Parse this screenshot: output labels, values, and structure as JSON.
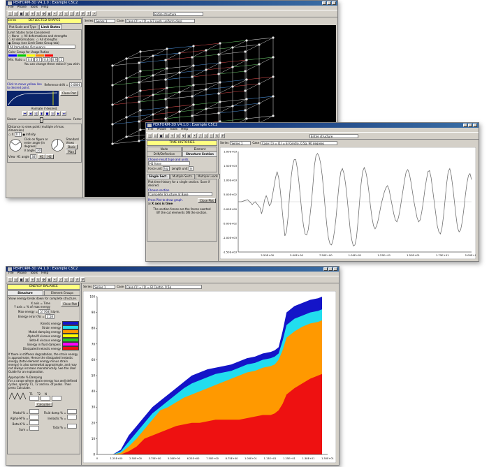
{
  "win1": {
    "title": "PERFORM-3D V4.1.0 : Example C5C2",
    "menu": [
      "File",
      "Phase",
      "Tools",
      "Help"
    ],
    "series": "Series 1",
    "case": "Case (2) = (7) = H7 push, uniform displ",
    "dropdown": "Entire structure",
    "panel_header": "DEFLECTED SHAPES",
    "tabs": [
      "Plot Scale and Type",
      "Limit States"
    ],
    "limit_title": "Limit States to be Considered",
    "opts": [
      "None",
      "All deformations and strengths",
      "All deformations",
      "All strengths",
      "Group (see Limit State Group tab)"
    ],
    "group_select": "All Immediate Occupancy",
    "color_group": "Color Group for Usage Ratios",
    "min_ratio_label": "Min. Ratio =",
    "ratios": [
      "0.6",
      "0.7",
      "0.8",
      "0.9",
      "1"
    ],
    "hint": "You can change these ratios if you wish.",
    "click_hint": "Click to move yellow line to desired point.",
    "ref_label": "Reference drift =",
    "ref_value": "0.0806",
    "close": "Close Plot",
    "animate": "Animate if desired.",
    "slower": "Slower",
    "faster": "Faster",
    "distance_label": "Distance to view point (multiple of max. dimension)",
    "x_label": "X",
    "x_value": "0.1",
    "infinity": "Infinity",
    "click_fig": "Click on figure or enter angle (in degrees)",
    "v_angle": "V angle",
    "v_value": "30",
    "h1_angle": "H1 angle",
    "h1_value": "30",
    "std_views": "Standard Views",
    "views": [
      "Basic",
      "Plan",
      "H1",
      "H2"
    ],
    "view": "View"
  },
  "win2": {
    "title": "PERFORM-3D V4.1.0 : Example C5C2",
    "panel_header": "TIME HISTORIES",
    "menu": [
      "File",
      "Phase",
      "Tools",
      "Help"
    ],
    "series": "Series 1",
    "case": "Case (1) = (1) = El Centro, 0.5g, 90 degrees",
    "dropdown": "Entire structure",
    "tabs_top": [
      "Node",
      "Element"
    ],
    "tabs_mid": [
      "Drift/Deflection",
      "Structure Section"
    ],
    "choose_result": "Choose result type and units.",
    "result": "H1 force",
    "force_unit_label": "Force unit",
    "force_unit": "kip",
    "length_unit_label": "Length unit",
    "length_unit": "in",
    "tabs_sub": [
      "Single Sect.",
      "Multiple Sects.",
      "Multiple Loads"
    ],
    "plot_desc": "Plot time history for a single section. Save if desired.",
    "choose_section": "Choose section",
    "section": "Complete Structure at Base",
    "press_plot": "Press Plot to draw graph.",
    "x_axis": "X axis is time",
    "close": "Close Plot",
    "note": "The section forces are the forces exerted BY the cut elements ON the section.",
    "chart_data": {
      "type": "line",
      "x": [
        0.0,
        0.2,
        0.4,
        0.6,
        0.8,
        0.9,
        1.0,
        1.1,
        1.2,
        1.3,
        1.4,
        1.5,
        1.6,
        1.7,
        1.8,
        1.9,
        2.0,
        2.1,
        2.2,
        2.3,
        2.4,
        2.5,
        2.6,
        2.7,
        2.8,
        2.9,
        3.0,
        3.1,
        3.2,
        3.3,
        3.4,
        3.5,
        3.6,
        3.7,
        3.8,
        3.9,
        4.0,
        4.1,
        4.2,
        4.3,
        4.4,
        4.5,
        4.6,
        4.7,
        4.8,
        4.9,
        5.0,
        5.1,
        5.2,
        5.3,
        5.4,
        5.5,
        5.6,
        5.7,
        5.8,
        5.9,
        6.0,
        6.1,
        6.2,
        6.3,
        6.4,
        6.5,
        6.6,
        6.7,
        6.8,
        6.9,
        7.0,
        7.1,
        7.2,
        7.3,
        7.4,
        7.5,
        7.6,
        7.7,
        7.8,
        7.9,
        8.0,
        8.1,
        8.2,
        8.3,
        8.4,
        8.5,
        8.6,
        8.7,
        8.8,
        8.9,
        9.0,
        9.1,
        9.2,
        9.3,
        9.4,
        9.5,
        9.6,
        9.7,
        9.8,
        9.9,
        10.0,
        10.1,
        10.2,
        10.3,
        10.4,
        10.5,
        10.6,
        10.7,
        10.8,
        10.9,
        11.0,
        11.1,
        11.2,
        11.3,
        11.4,
        11.5,
        11.6,
        11.7,
        11.8,
        11.9,
        12.0,
        12.1,
        12.2,
        12.3,
        12.4,
        12.5,
        12.6,
        12.7,
        12.8,
        12.9,
        13.0,
        13.1,
        13.2,
        13.3,
        13.4,
        13.5,
        13.6,
        13.7,
        13.8,
        13.9,
        14.0,
        14.1,
        14.2,
        14.3,
        14.4,
        14.5,
        14.6,
        14.7,
        14.8,
        14.9,
        15.0
      ],
      "y": [
        0,
        0,
        10,
        20,
        -10,
        -30,
        -10,
        0,
        -20,
        -40,
        -60,
        -120,
        -60,
        20,
        60,
        20,
        -40,
        -20,
        60,
        150,
        240,
        300,
        240,
        120,
        -40,
        -200,
        -340,
        -300,
        -160,
        60,
        240,
        360,
        420,
        420,
        330,
        200,
        40,
        -120,
        -240,
        -320,
        -330,
        -280,
        -160,
        -20,
        160,
        360,
        460,
        480,
        450,
        380,
        260,
        100,
        -80,
        -240,
        -360,
        -420,
        -430,
        -380,
        -280,
        -140,
        40,
        200,
        300,
        330,
        280,
        180,
        40,
        -120,
        -280,
        -380,
        -440,
        -430,
        -360,
        -200,
        0,
        180,
        300,
        340,
        300,
        220,
        100,
        -40,
        -160,
        -240,
        -270,
        -240,
        -180,
        -100,
        -20,
        40,
        100,
        140,
        160,
        120,
        40,
        -40,
        -120,
        -180,
        -200,
        -160,
        -80,
        20,
        120,
        220,
        300,
        320,
        280,
        200,
        100,
        0,
        -80,
        -160,
        -200,
        -180,
        -100,
        0,
        120,
        220,
        300,
        310,
        240,
        120,
        0,
        -120,
        -240,
        -300,
        -320,
        -260,
        -140,
        20,
        180,
        300,
        330,
        260,
        140,
        0,
        -140,
        -260,
        -300,
        -280,
        -200,
        -80,
        60,
        180,
        260,
        280,
        220,
        120,
        0,
        -80,
        -40
      ],
      "xlim": [
        0,
        15
      ],
      "ylim": [
        -500,
        500
      ],
      "xticks": [
        "2.50E+00",
        "5.00E+00",
        "7.50E+00",
        "1.00E+01",
        "1.25E+01",
        "1.50E+01",
        "1.75E+01",
        "2.00E+01"
      ],
      "yticks": [
        "1.00E+03",
        "1.50E+03",
        "1.00E+03",
        "5.00E+02",
        "0.00E+00",
        "-5.00E+02",
        "-1.00E+03",
        "-1.50E+03"
      ]
    }
  },
  "win3": {
    "title": "PERFORM-3D V4.1.0 : Example C5C2",
    "menu": [
      "File",
      "Phase",
      "Tools",
      "Help"
    ],
    "series": "Series 1",
    "case": "Case (1) = (1) = El Centro, 0.5g",
    "panel_header": "ENERGY BALANCE",
    "tabs": [
      "Structure",
      "Element Groups"
    ],
    "show_text": "Show energy break down for complete structure.",
    "x_axis": "X axis = Time",
    "y_axis": "Y axis = % of max energy",
    "close": "Close Plot",
    "max_energy_label": "Max energy =",
    "max_energy": "57768",
    "max_energy_unit": "kip-in.",
    "energy_error_label": "Energy error (%) =",
    "energy_error": "2.58",
    "legend": [
      {
        "name": "Kinetic energy",
        "color": "#1414c8"
      },
      {
        "name": "Strain energy",
        "color": "#22ddee"
      },
      {
        "name": "Modal damping energy",
        "color": "#ff9900"
      },
      {
        "name": "Alpha-M viscous energy",
        "color": "#ffff00"
      },
      {
        "name": "Beta-K viscous energy",
        "color": "#22cc22"
      },
      {
        "name": "Energy in fluid dampers",
        "color": "#ff00ff"
      },
      {
        "name": "Dissipated inelastic energy",
        "color": "#ee1111"
      }
    ],
    "desc": "If there is stiffness degradation, the strain energy is approximate. Hence the dissipated inelastic energy (total element energy minus strain energy) is also somewhat approximate, and may not always increase monotonically. See the User Guide for an explanation.",
    "damping_title": "Appropriate % Damping",
    "damping_desc": "For a range where strain energy has well defined cycles, specify T1, T2 and no. of peaks. Then press Calculate.",
    "param_labels": [
      "T1",
      "T2",
      "N"
    ],
    "calculate": "Calculate",
    "results_left": [
      "Modal % =",
      "Alpha-M % =",
      "Beta-K % =",
      "Sum ="
    ],
    "results_right": [
      "Fluid damp % =",
      "Inelastic % =",
      "",
      "Total % ="
    ],
    "chart_data": {
      "type": "area",
      "x": [
        0,
        1,
        1.5,
        2,
        2.5,
        3,
        3.5,
        4,
        4.5,
        5,
        5.5,
        6,
        6.5,
        7,
        7.5,
        8,
        8.5,
        9,
        9.5,
        10,
        10.5,
        11,
        11.25,
        11.5,
        11.75,
        12,
        12.5,
        13,
        13.5,
        14,
        14.25
      ],
      "series": [
        {
          "name": "Dissipated inelastic energy",
          "values": [
            0,
            0,
            0,
            2,
            5,
            10,
            12,
            14,
            16,
            18,
            19,
            20,
            20,
            21,
            22,
            22,
            22,
            22,
            23,
            24,
            25,
            25,
            26,
            28,
            32,
            38,
            42,
            45,
            48,
            50,
            51
          ]
        },
        {
          "name": "Modal damping energy",
          "values": [
            0,
            0,
            1,
            5,
            10,
            16,
            22,
            28,
            30,
            33,
            36,
            38,
            40,
            42,
            44,
            46,
            48,
            50,
            52,
            53,
            55,
            56,
            57,
            60,
            66,
            74,
            78,
            81,
            83,
            84,
            85
          ]
        },
        {
          "name": "Strain energy",
          "values": [
            0,
            0,
            2,
            8,
            14,
            20,
            26,
            30,
            34,
            38,
            42,
            45,
            47,
            49,
            51,
            52,
            53,
            55,
            57,
            58,
            60,
            61,
            62,
            64,
            72,
            82,
            86,
            88,
            90,
            91,
            92
          ]
        },
        {
          "name": "Kinetic energy",
          "values": [
            0,
            0,
            3,
            12,
            18,
            24,
            30,
            34,
            38,
            42,
            46,
            50,
            52,
            54,
            55,
            56,
            57,
            59,
            61,
            62,
            64,
            65,
            66,
            68,
            78,
            90,
            94,
            96,
            98,
            99,
            100
          ]
        }
      ],
      "xlim": [
        0,
        14.25
      ],
      "ylim": [
        0,
        100
      ],
      "yticks": [
        "0",
        "10",
        "20",
        "30",
        "40",
        "50",
        "60",
        "70",
        "80",
        "90",
        "100"
      ],
      "xticks": [
        "0",
        "1.25E+00",
        "2.50E+00",
        "3.75E+00",
        "5.00E+00",
        "6.25E+00",
        "7.50E+00",
        "8.75E+00",
        "1.00E+01",
        "1.13E+01",
        "1.25E+01",
        "1.38E+01",
        "1.50E+01"
      ]
    }
  }
}
